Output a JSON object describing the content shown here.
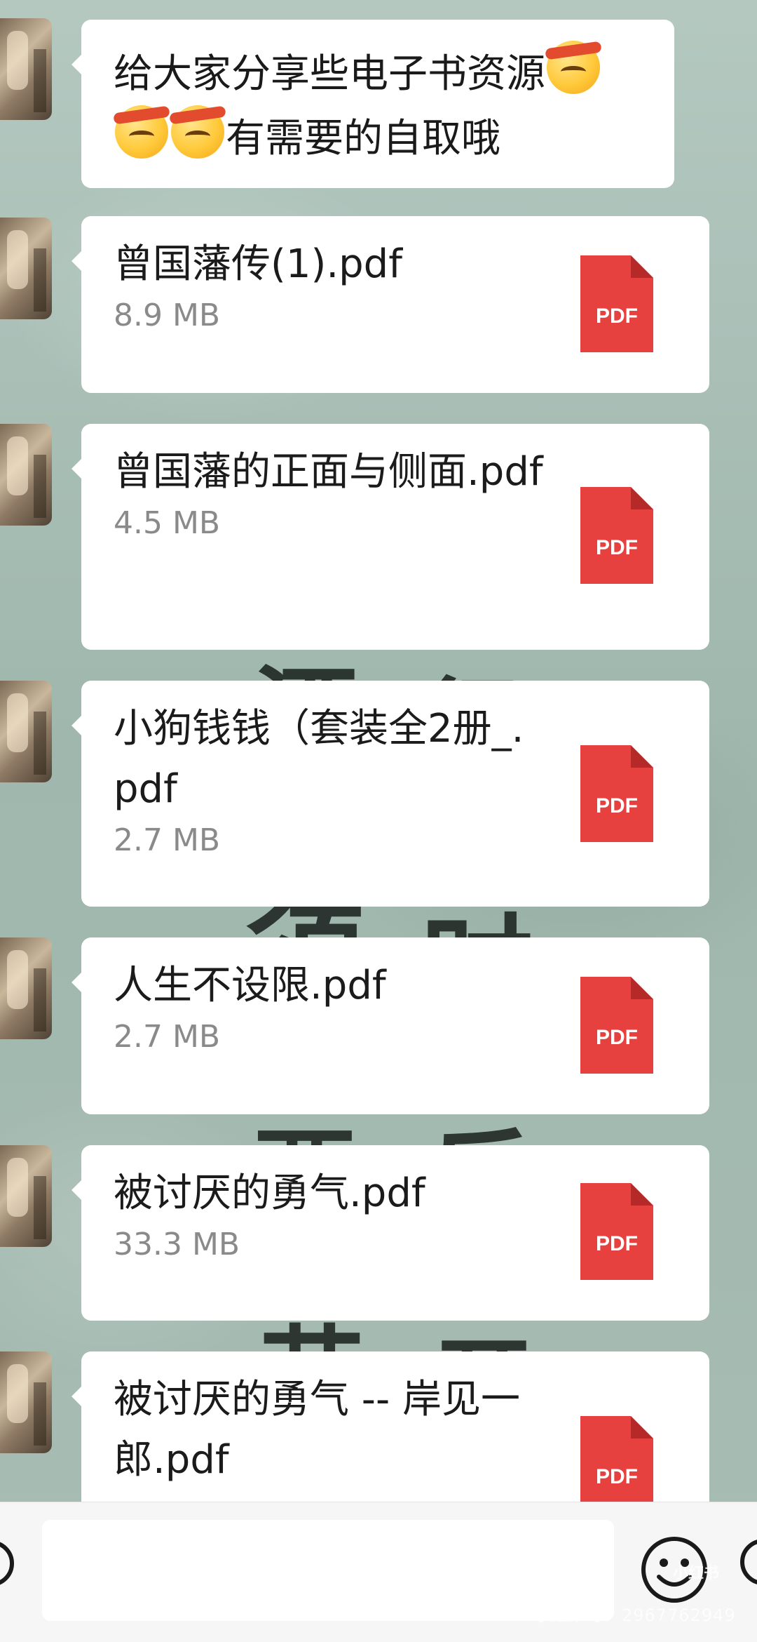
{
  "messages": [
    {
      "type": "text",
      "line1": "给大家分享些电子书资源",
      "line2": "有需要的自取哦",
      "emoji": "shushing-face-emoji"
    },
    {
      "type": "file",
      "name": "曾国藩传(1).pdf",
      "size": "8.9 MB",
      "icon_label": "PDF"
    },
    {
      "type": "file",
      "name": "曾国藩的正面与侧面.pdf",
      "size": "4.5 MB",
      "icon_label": "PDF"
    },
    {
      "type": "file",
      "name": "小狗钱钱（套装全2册_.pdf",
      "size": "2.7 MB",
      "icon_label": "PDF"
    },
    {
      "type": "file",
      "name": "人生不设限.pdf",
      "size": "2.7 MB",
      "icon_label": "PDF"
    },
    {
      "type": "file",
      "name": "被讨厌的勇气.pdf",
      "size": "33.3 MB",
      "icon_label": "PDF"
    },
    {
      "type": "file",
      "name": "被讨厌的勇气 -- 岸见一郎.pdf",
      "size": "",
      "icon_label": "PDF"
    }
  ],
  "input_bar": {
    "placeholder": "",
    "icons": [
      "voice-icon",
      "emoji-icon",
      "plus-icon"
    ]
  },
  "watermark": {
    "text": "小红书号：2967762949",
    "logo": "小红书"
  },
  "colors": {
    "pdf_red": "#e6413f",
    "bubble_bg": "#ffffff",
    "size_gray": "#8a8a8a"
  }
}
